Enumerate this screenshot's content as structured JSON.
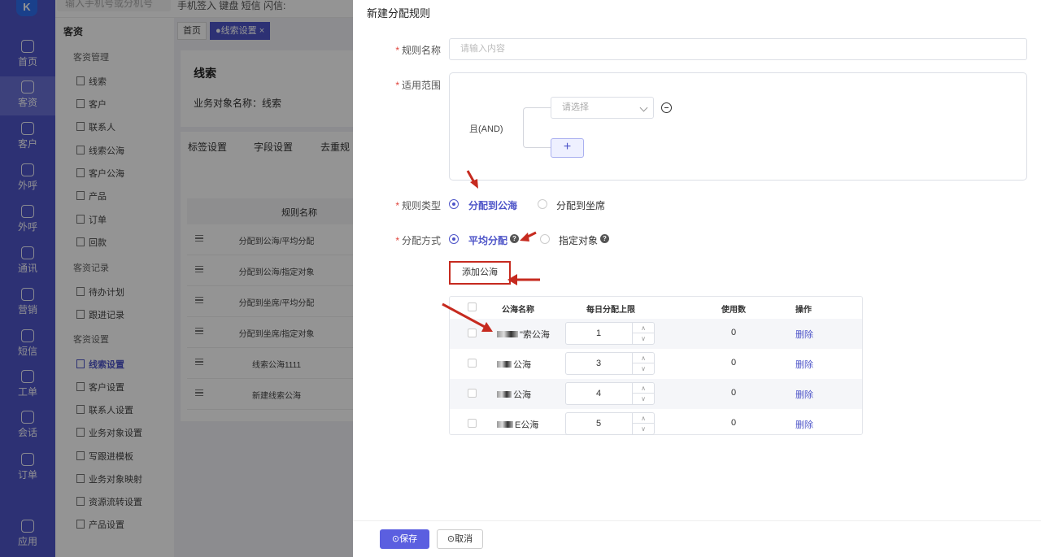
{
  "topbar": {
    "search_placeholder": "输入手机号或分机号",
    "links": "手机签入  键盘  短信  闪信:"
  },
  "nav": [
    {
      "label": "首页",
      "icon": "home-icon"
    },
    {
      "label": "客资",
      "icon": "users-icon",
      "active": true
    },
    {
      "label": "客户",
      "icon": "user-icon"
    },
    {
      "label": "外呼",
      "icon": "phone-out-icon"
    },
    {
      "label": "外呼",
      "icon": "phone-in-icon"
    },
    {
      "label": "通讯",
      "icon": "contacts-icon"
    },
    {
      "label": "营销",
      "icon": "gear-icon"
    },
    {
      "label": "短信",
      "icon": "mail-icon"
    },
    {
      "label": "工单",
      "icon": "clipboard-icon"
    },
    {
      "label": "会话",
      "icon": "chat-icon"
    },
    {
      "label": "订单",
      "icon": "order-icon"
    },
    {
      "label": "应用",
      "icon": "app-icon"
    }
  ],
  "sidebar": {
    "title": "客资",
    "groups": [
      "客资管理",
      "客资记录",
      "客资设置"
    ],
    "items_mgmt": [
      "线索",
      "客户",
      "联系人",
      "线索公海",
      "客户公海",
      "产品",
      "订单",
      "回款"
    ],
    "items_records": [
      "待办计划",
      "跟进记录"
    ],
    "items_settings": [
      "线索设置",
      "客户设置",
      "联系人设置",
      "业务对象设置",
      "写跟进模板",
      "业务对象映射",
      "资源流转设置",
      "产品设置"
    ]
  },
  "main": {
    "tab_home": "首页",
    "tab_active": "●线索设置 ×",
    "card_title": "线索",
    "card_sub": "业务对象名称：线索",
    "ctabs": [
      "标签设置",
      "字段设置",
      "去重规"
    ],
    "col_header": "规则名称",
    "rules": [
      "分配到公海/平均分配",
      "分配到公海/指定对象",
      "分配到坐席/平均分配",
      "分配到坐席/指定对象",
      "线索公海1111",
      "新建线索公海"
    ]
  },
  "drawer": {
    "title": "新建分配规则",
    "rule_name_label": "规则名称",
    "rule_name_placeholder": "请输入内容",
    "scope_label": "适用范围",
    "and_label": "且(AND)",
    "select_placeholder": "请选择",
    "plus": "+",
    "rule_type_label": "规则类型",
    "rule_type_opt1": "分配到公海",
    "rule_type_opt2": "分配到坐席",
    "method_label": "分配方式",
    "method_opt1": "平均分配",
    "method_opt2": "指定对象",
    "help": "?",
    "add_pool_btn": "添加公海",
    "table_headers": {
      "name": "公海名称",
      "limit": "每日分配上限",
      "used": "使用数",
      "ops": "操作"
    },
    "rows": [
      {
        "name": "\"索公海",
        "limit": "1",
        "used": "0",
        "op": "删除"
      },
      {
        "name": "公海",
        "limit": "3",
        "used": "0",
        "op": "删除"
      },
      {
        "name": "公海",
        "limit": "4",
        "used": "0",
        "op": "删除"
      },
      {
        "name": "E公海",
        "limit": "5",
        "used": "0",
        "op": "删除"
      }
    ],
    "save_btn": "⊙保存",
    "cancel_btn": "⊙取消"
  },
  "colors": {
    "accent": "#4e55c8",
    "annotation_red": "#c62a1f"
  }
}
